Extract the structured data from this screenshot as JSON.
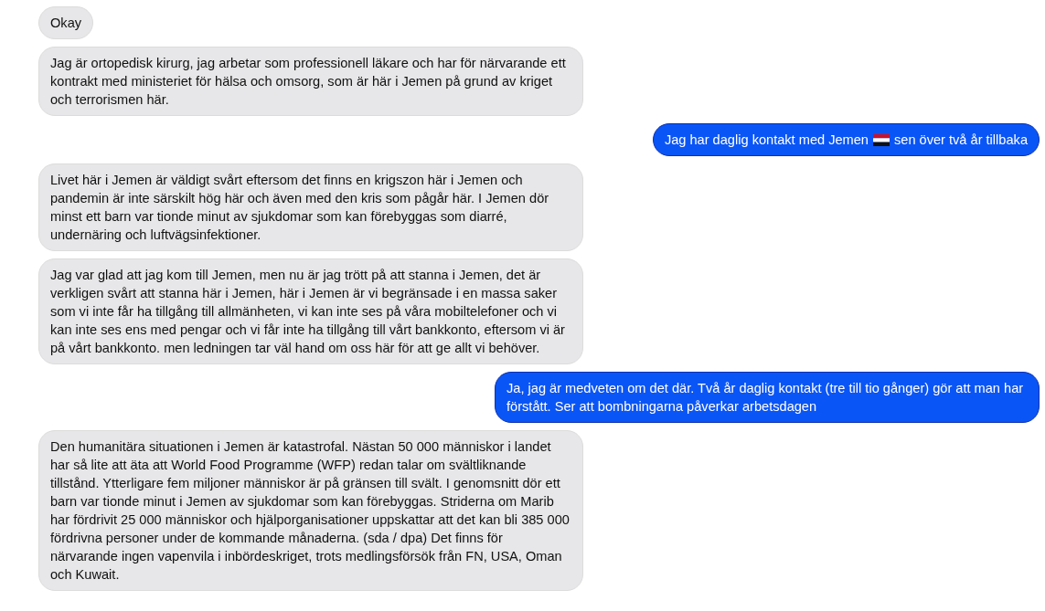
{
  "messages": [
    {
      "sent": false,
      "segments": [
        {
          "kind": "text",
          "text": "Okay"
        }
      ]
    },
    {
      "sent": false,
      "segments": [
        {
          "kind": "text",
          "text": "Jag är ortopedisk kirurg, jag arbetar som professionell läkare och har för närvarande ett kontrakt med ministeriet för hälsa och omsorg, som är här i Jemen på grund av kriget och terrorismen här."
        }
      ]
    },
    {
      "sent": true,
      "segments": [
        {
          "kind": "text",
          "text": "Jag har daglig kontakt med Jemen"
        },
        {
          "kind": "flag"
        },
        {
          "kind": "text",
          "text": "sen över två år tillbaka"
        }
      ]
    },
    {
      "sent": false,
      "segments": [
        {
          "kind": "text",
          "text": "Livet här i Jemen är väldigt svårt eftersom det finns en krigszon här i Jemen och pandemin är inte särskilt hög här och även med den kris som pågår här. I Jemen dör minst ett barn var tionde minut av sjukdomar som kan förebyggas som diarré, undernäring och luftvägsinfektioner."
        }
      ]
    },
    {
      "sent": false,
      "segments": [
        {
          "kind": "text",
          "text": "Jag var glad att jag kom till Jemen, men nu är jag trött på att stanna i Jemen, det är verkligen svårt att stanna här i Jemen, här i Jemen är vi begränsade i en massa saker som vi inte får ha tillgång till allmänheten, vi kan inte ses på våra mobiltelefoner och vi kan inte ses ens med pengar och vi får inte ha tillgång till vårt bankkonto, eftersom vi är på vårt bankkonto. men ledningen tar väl hand om oss här för att ge allt vi behöver."
        }
      ]
    },
    {
      "sent": true,
      "segments": [
        {
          "kind": "text",
          "text": "Ja, jag är medveten om det där. Två år daglig kontakt (tre till tio gånger) gör att man har förstått. Ser att bombningarna påverkar arbetsdagen"
        }
      ]
    },
    {
      "sent": false,
      "segments": [
        {
          "kind": "text",
          "text": "Den humanitära situationen i Jemen är katastrofal. Nästan 50 000 människor i landet har så lite att äta att World Food Programme (WFP) redan talar om svältliknande tillstånd. Ytterligare fem miljoner människor är på gränsen till svält. I genomsnitt dör ett barn var tionde minut i Jemen av sjukdomar som kan förebyggas. Striderna om Marib har fördrivit 25 000 människor och hjälporganisationer uppskattar att det kan bli 385 000 fördrivna personer under de kommande månaderna. (sda / dpa) Det finns för närvarande ingen vapenvila i inbördeskriget, trots medlingsförsök från FN, USA, Oman och Kuwait."
        }
      ]
    }
  ]
}
